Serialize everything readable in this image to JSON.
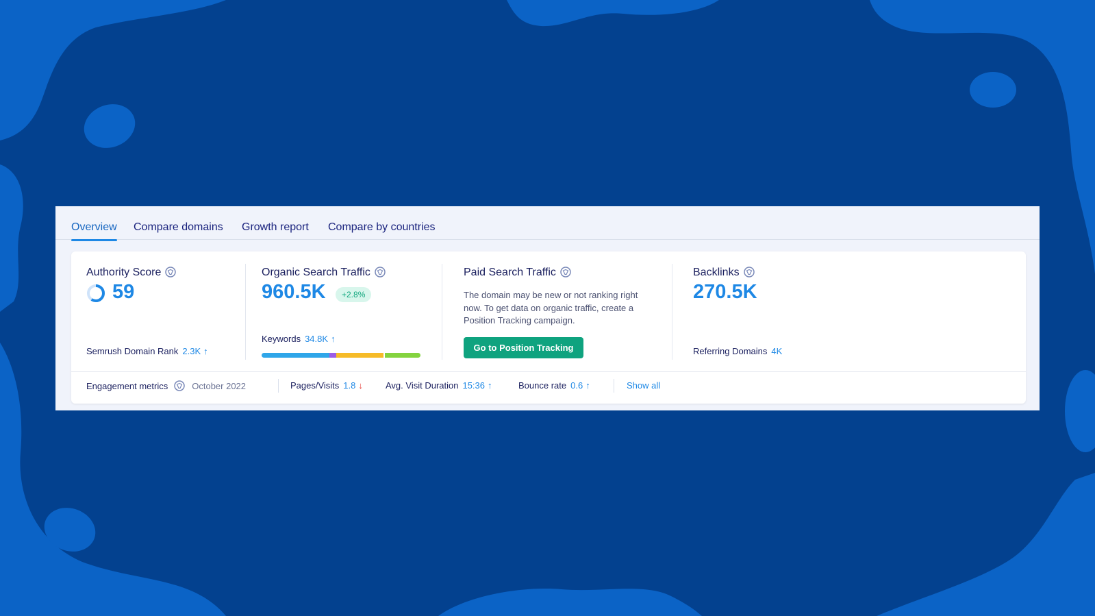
{
  "tabs": [
    {
      "label": "Overview",
      "active": true
    },
    {
      "label": "Compare domains"
    },
    {
      "label": "Growth report"
    },
    {
      "label": "Compare by countries"
    }
  ],
  "authority": {
    "title": "Authority Score",
    "value": "59",
    "rank_label": "Semrush Domain Rank",
    "rank_value": "2.3K",
    "rank_trend": "↑"
  },
  "organic": {
    "title": "Organic Search Traffic",
    "value": "960.5K",
    "change": "+2.8%",
    "keywords_label": "Keywords",
    "keywords_value": "34.8K",
    "keywords_trend": "↑",
    "distribution_colors": [
      "#2fa6e9",
      "#9c5de6",
      "#f6bb28",
      "#84d33f"
    ]
  },
  "paid": {
    "title": "Paid Search Traffic",
    "description": "The domain may be new or not ranking right now. To get data on organic traffic, create a Position Tracking campaign.",
    "cta": "Go to Position Tracking"
  },
  "backlinks": {
    "title": "Backlinks",
    "value": "270.5K",
    "ref_label": "Referring Domains",
    "ref_value": "4K"
  },
  "engagement": {
    "label": "Engagement metrics",
    "date": "October 2022",
    "pages_label": "Pages/Visits",
    "pages_value": "1.8",
    "pages_trend": "↓",
    "duration_label": "Avg. Visit Duration",
    "duration_value": "15:36",
    "duration_trend": "↑",
    "bounce_label": "Bounce rate",
    "bounce_value": "0.6",
    "bounce_trend": "↑",
    "show_all": "Show all"
  },
  "colors": {
    "background": "#03418f",
    "blob": "#0b63c6",
    "accent": "#1e88e5",
    "cta": "#0fa37f"
  }
}
